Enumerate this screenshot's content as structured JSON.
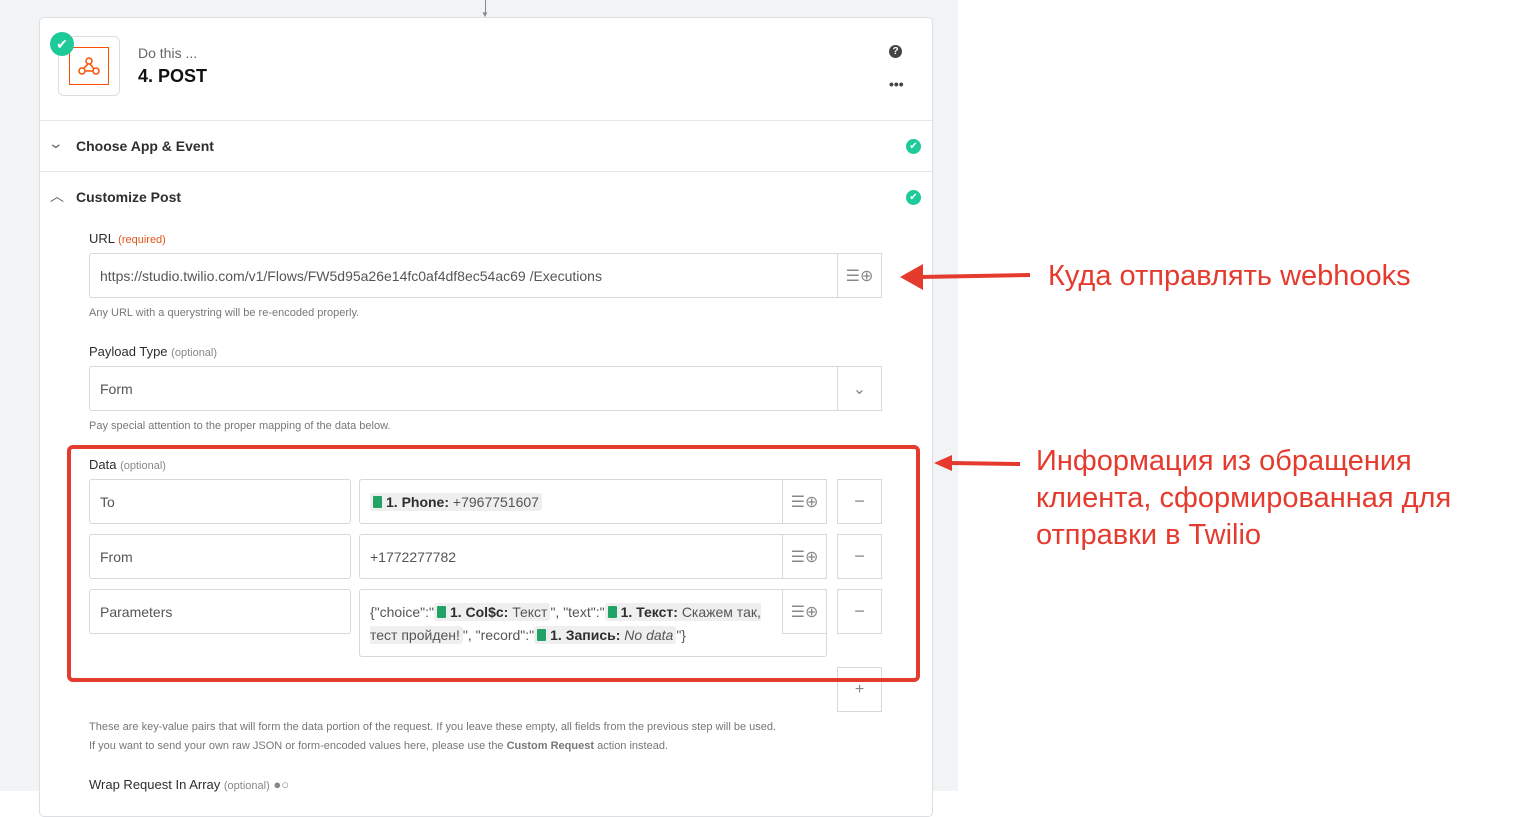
{
  "step": {
    "subtitle": "Do this ...",
    "title": "4. POST"
  },
  "sections": [
    {
      "label": "Choose App & Event"
    },
    {
      "label": "Customize Post"
    }
  ],
  "url": {
    "label": "URL",
    "req": "(required)",
    "value": "https://studio.twilio.com/v1/Flows/FW5d95a26e14fc0af4df8ec54ac69 /Executions",
    "hint": "Any URL with a querystring will be re-encoded properly."
  },
  "payload": {
    "label": "Payload Type",
    "opt": "(optional)",
    "value": "Form",
    "hint": "Pay special attention to the proper mapping of the data below."
  },
  "data": {
    "label": "Data",
    "opt": "(optional)",
    "rows": [
      {
        "key": "To",
        "pill_label": "1. Phone:",
        "pill_value": "+7967751607"
      },
      {
        "key": "From",
        "value": "+1772277782"
      },
      {
        "key": "Parameters",
        "p1": "{\"choice\":\"",
        "c1l": "1. Col$c:",
        "c1v": "Текст",
        "p2": "\", \"text\":\"",
        "c2l": "1. Текст:",
        "c2v": "Скажем так, тест пройден!",
        "p3": "\", \"record\":\"",
        "c3l": "1. Запись:",
        "c3v": "No data",
        "p4": "\"}"
      }
    ],
    "hint1": "These are key-value pairs that will form the data portion of the request. If you leave these empty, all fields from the previous step will be used.",
    "hint2a": "If you want to send your own raw JSON or form-encoded values here, please use the ",
    "hint2b": "Custom Request",
    "hint2c": " action instead."
  },
  "wrap": {
    "label": "Wrap Request In Array",
    "opt": "(optional)"
  },
  "annotations": {
    "a1": "Куда отправлять webhooks",
    "a2": "Информация из обращения клиента, сформированная для отправки в Twilio"
  }
}
